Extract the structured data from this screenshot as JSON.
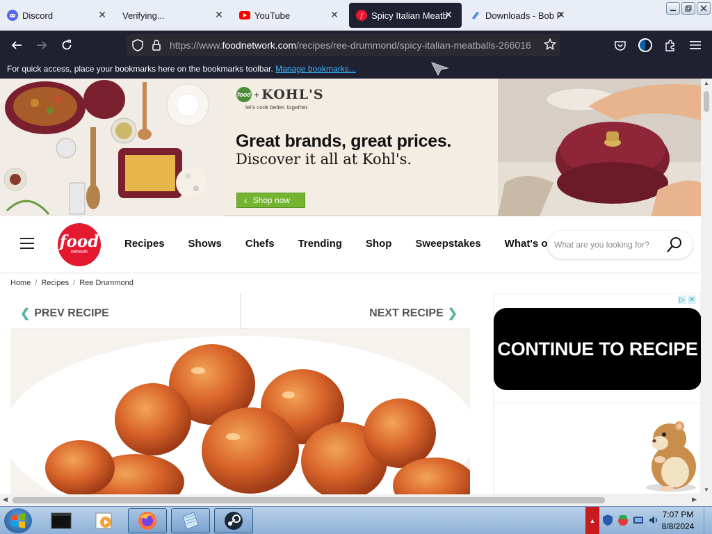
{
  "browser": {
    "tabs": [
      {
        "label": "Discord",
        "icon": "discord-icon",
        "active": false
      },
      {
        "label": "Verifying...",
        "icon": "",
        "active": false
      },
      {
        "label": "YouTube",
        "icon": "youtube-icon",
        "active": false
      },
      {
        "label": "Spicy Italian Meatbal",
        "icon": "food-network-icon",
        "active": true
      },
      {
        "label": "Downloads - Bob Po",
        "icon": "cloud-icon",
        "active": false
      }
    ],
    "close_glyph": "✕",
    "url_prefix": "https://www.",
    "url_host": "foodnetwork.com",
    "url_path": "/recipes/ree-drummond/spicy-italian-meatballs-266016",
    "bookmarks_text": "For quick access, place your bookmarks here on the bookmarks toolbar.",
    "bookmarks_link": "Manage bookmarks..."
  },
  "ad_banner": {
    "brand": "KOHL'S",
    "fn_mini": "food",
    "tagline": "let's cook better. together.",
    "headline": "Great brands, great prices.",
    "subheadline": "Discover it all at Kohl's.",
    "cta": "Shop now",
    "cta_icon": "‹",
    "accent_color": "#75b430"
  },
  "site": {
    "logo_word": "food",
    "logo_sub": "network",
    "logo_color": "#e4182f",
    "menu": [
      "Recipes",
      "Shows",
      "Chefs",
      "Trending",
      "Shop",
      "Sweepstakes",
      "What's on TV"
    ],
    "search_placeholder": "What are you looking for?"
  },
  "breadcrumb": [
    "Home",
    "Recipes",
    "Ree Drummond"
  ],
  "breadcrumb_sep": "/",
  "recipe": {
    "prev_label": "PREV RECIPE",
    "next_label": "NEXT RECIPE",
    "prev_icon": "❮",
    "next_icon": "❯",
    "accent_color": "#5ab3a1"
  },
  "side_ad": {
    "cta": "CONTINUE TO RECIPE",
    "adchoices": [
      "▷",
      "✕"
    ]
  },
  "taskbar": {
    "apps": [
      "terminal-icon",
      "media-player-icon",
      "firefox-icon",
      "notepad-icon",
      "steam-icon"
    ],
    "time": "7:07 PM",
    "date": "8/8/2024",
    "tray_arrow": "▲"
  }
}
